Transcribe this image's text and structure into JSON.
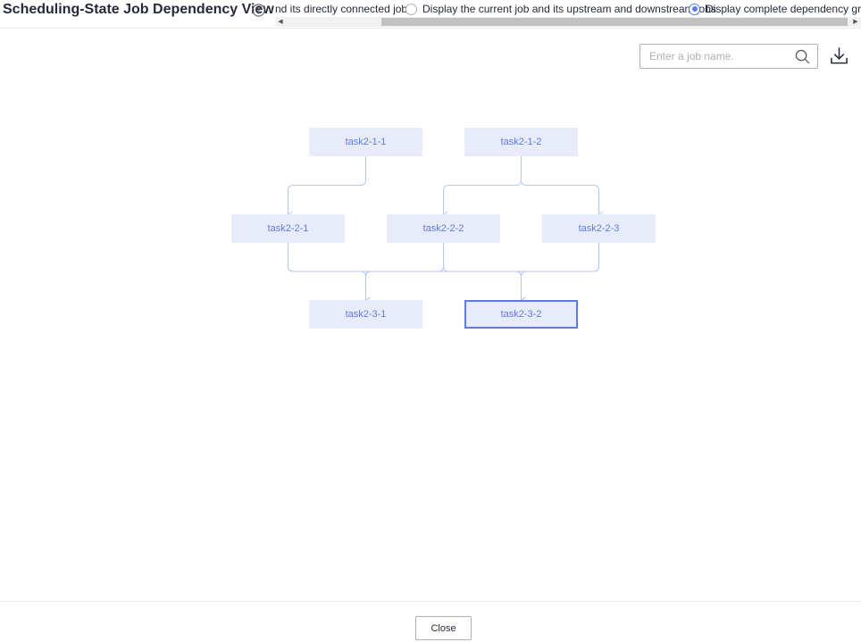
{
  "dialog": {
    "title": "Scheduling-State Job Dependency View",
    "help_icon": "question-circle-icon"
  },
  "view_options": [
    {
      "label": "nd its directly connected jobs",
      "checked": false,
      "show_radio": false
    },
    {
      "label": "Display the current job and its upstream and downstream jobs",
      "checked": false,
      "show_radio": true
    },
    {
      "label": "Display complete dependency graphs",
      "checked": true,
      "show_radio": true
    }
  ],
  "search": {
    "placeholder": "Enter a job name.",
    "value": "",
    "icon": "search-icon"
  },
  "download": {
    "icon": "download-icon"
  },
  "graph": {
    "nodes": [
      {
        "id": "task2-1-1",
        "label": "task2-1-1",
        "selected": false
      },
      {
        "id": "task2-1-2",
        "label": "task2-1-2",
        "selected": false
      },
      {
        "id": "task2-2-1",
        "label": "task2-2-1",
        "selected": false
      },
      {
        "id": "task2-2-2",
        "label": "task2-2-2",
        "selected": false
      },
      {
        "id": "task2-2-3",
        "label": "task2-2-3",
        "selected": false
      },
      {
        "id": "task2-3-1",
        "label": "task2-3-1",
        "selected": false
      },
      {
        "id": "task2-3-2",
        "label": "task2-3-2",
        "selected": true
      }
    ],
    "edges": [
      [
        "task2-1-1",
        "task2-2-1"
      ],
      [
        "task2-1-2",
        "task2-2-2"
      ],
      [
        "task2-1-2",
        "task2-2-3"
      ],
      [
        "task2-2-1",
        "task2-3-1"
      ],
      [
        "task2-2-2",
        "task2-3-1"
      ],
      [
        "task2-2-3",
        "task2-3-1"
      ],
      [
        "task2-2-1",
        "task2-3-2"
      ],
      [
        "task2-2-2",
        "task2-3-2"
      ],
      [
        "task2-2-3",
        "task2-3-2"
      ]
    ],
    "colors": {
      "node_fill": "#e8ebf9",
      "node_text": "#5e7ce0",
      "edge": "#b8c7f2",
      "selected_border": "#5e7ce0"
    }
  },
  "footer": {
    "close_label": "Close"
  }
}
